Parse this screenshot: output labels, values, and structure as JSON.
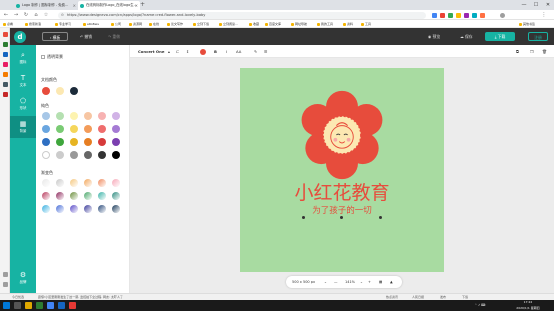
{
  "browser": {
    "tabs": [
      {
        "label": "Logo 制作 | 图标制作 - 免费…"
      },
      {
        "label": "在线商标制作Logo_在线logo生…"
      }
    ],
    "new_tab_label": "+",
    "window_controls": {
      "minimize": "—",
      "maximize": "☐",
      "close": "✕"
    },
    "url": "https://www.designevo.com/cn/apps/logo/?name=red-flower-and-lovely-baby",
    "bookmarks": [
      "必看",
      "搜索新浪",
      "专业学习",
      "eRoBeis",
      "公司",
      "资源网",
      "在线",
      "论文写作",
      "立刻下载",
      "立刻阅读…",
      "收藏",
      "百度文库",
      "网址导航",
      "我的工具",
      "资料",
      "工具",
      "其他书签"
    ]
  },
  "toolbar": {
    "template_label": "模板",
    "undo_label": "撤销",
    "redo_label": "重做",
    "preview_label": "预览",
    "save_label": "保存",
    "download_label": "下载",
    "login_label": "注册"
  },
  "sidebar": {
    "items": [
      {
        "icon": "search-icon",
        "glyph": "⌕",
        "label": "图标"
      },
      {
        "icon": "text-icon",
        "glyph": "T",
        "label": "文本"
      },
      {
        "icon": "shape-icon",
        "glyph": "⬠",
        "label": "形状"
      },
      {
        "icon": "background-icon",
        "glyph": "▦",
        "label": "背景"
      }
    ],
    "brand_label": "品牌",
    "active_index": 3
  },
  "panel": {
    "transparent_label": "透明背景",
    "doc_colors_title": "文档颜色",
    "doc_colors": [
      "#e74c3c",
      "#fce8b2",
      "#1c2b3a"
    ],
    "solid_title": "纯色",
    "solid_colors": [
      "#a7c7e7",
      "#b5e0b1",
      "#fdf3b0",
      "#f7c6a3",
      "#f7b2b2",
      "#d1b3e6",
      "#6aa6e0",
      "#7acb74",
      "#f5d65b",
      "#f39c5a",
      "#ef6d6d",
      "#a57bd4",
      "#2e6fc2",
      "#3fa63c",
      "#e6b422",
      "#e67e22",
      "#d63b3b",
      "#7b3fb0",
      "#ffffff",
      "#cccccc",
      "#999999",
      "#666666",
      "#333333",
      "#000000"
    ],
    "gradient_title": "渐变色",
    "gradient_colors": [
      "#e8e8e8",
      "#c8c8c8",
      "#f5c77e",
      "#f2a65a",
      "#f08a5d",
      "#f7a8b8",
      "#b83b5e",
      "#8e2b5e",
      "#6a8d3a",
      "#4aa86a",
      "#3bb3a8",
      "#2e8b7f",
      "#3ab0e0",
      "#4a6fd8",
      "#5a4ac8",
      "#3a3a9a",
      "#2a4a7a",
      "#1a3a5a"
    ]
  },
  "subtoolbar": {
    "font_name": "Concert One",
    "font_size": "",
    "color": "#e74c3c",
    "items": [
      "B",
      "I",
      "AA",
      "✎",
      "☰"
    ]
  },
  "canvas": {
    "background_color": "#a8dba1",
    "title": "小红花教育",
    "subtitle": "为了孩子的一切",
    "accent": "#e74c3c"
  },
  "zoom": {
    "size_label": "500 x 500 px",
    "minus": "—",
    "value": "141%",
    "plus": "+"
  },
  "statusbar": {
    "left": "今日优选",
    "message": "震惊!小区里刚刚发生了这一幕, 监控拍下全过程, 网友: 太吓人了",
    "right_items": [
      "热点资讯",
      "人民日报",
      "发布",
      "下载"
    ]
  },
  "taskbar": {
    "time": "17:22",
    "date": "2020/1/1 星期四"
  }
}
